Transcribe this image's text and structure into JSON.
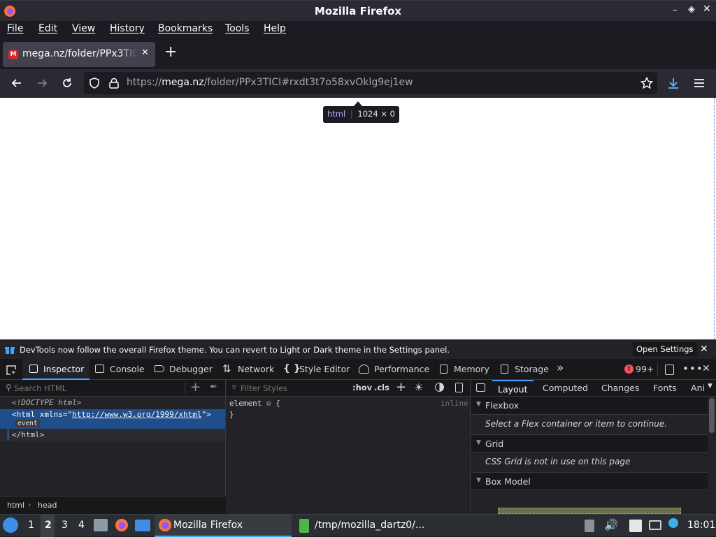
{
  "window": {
    "title": "Mozilla Firefox"
  },
  "menu": [
    "File",
    "Edit",
    "View",
    "History",
    "Bookmarks",
    "Tools",
    "Help"
  ],
  "tab": {
    "title": "mega.nz/folder/PPx3TICI"
  },
  "url": {
    "prefix": "https://",
    "domain": "mega.nz",
    "path": "/folder/PPx3TICI#rxdt3t7o58xvOklg9ej1ew"
  },
  "tooltip": {
    "tag": "html",
    "size": "1024 × 0"
  },
  "notification": {
    "text": "DevTools now follow the overall Firefox theme. You can revert to Light or Dark theme in the Settings panel.",
    "button": "Open Settings"
  },
  "devtools": {
    "tabs": [
      "Inspector",
      "Console",
      "Debugger",
      "Network",
      "Style Editor",
      "Performance",
      "Memory",
      "Storage"
    ],
    "error_count": "99+",
    "search_placeholder": "Search HTML",
    "filter_placeholder": "Filter Styles",
    "hov": ":hov",
    "cls": ".cls",
    "markup": {
      "doctype": "<!DOCTYPE html>",
      "html_open_pre": "<html xmlns=\"",
      "xmlns": "http://www.w3.org/1999/xhtml",
      "html_open_post": "\">",
      "event": "event",
      "html_close": "</html>"
    },
    "rule": {
      "selector": "element",
      "brace_open": "{",
      "brace_close": "}",
      "source": "inline"
    },
    "breadcrumb": [
      "html",
      "head"
    ],
    "sidebar_tabs": [
      "Layout",
      "Computed",
      "Changes",
      "Fonts",
      "Ani"
    ],
    "sections": [
      {
        "title": "Flexbox",
        "message": "Select a Flex container or item to continue."
      },
      {
        "title": "Grid",
        "message": "CSS Grid is not in use on this page"
      },
      {
        "title": "Box Model"
      }
    ]
  },
  "taskbar": {
    "desktops": [
      "1",
      "2",
      "3",
      "4"
    ],
    "tasks": [
      "Mozilla Firefox",
      "/tmp/mozilla_dartz0/..."
    ],
    "clock": "18:01"
  }
}
